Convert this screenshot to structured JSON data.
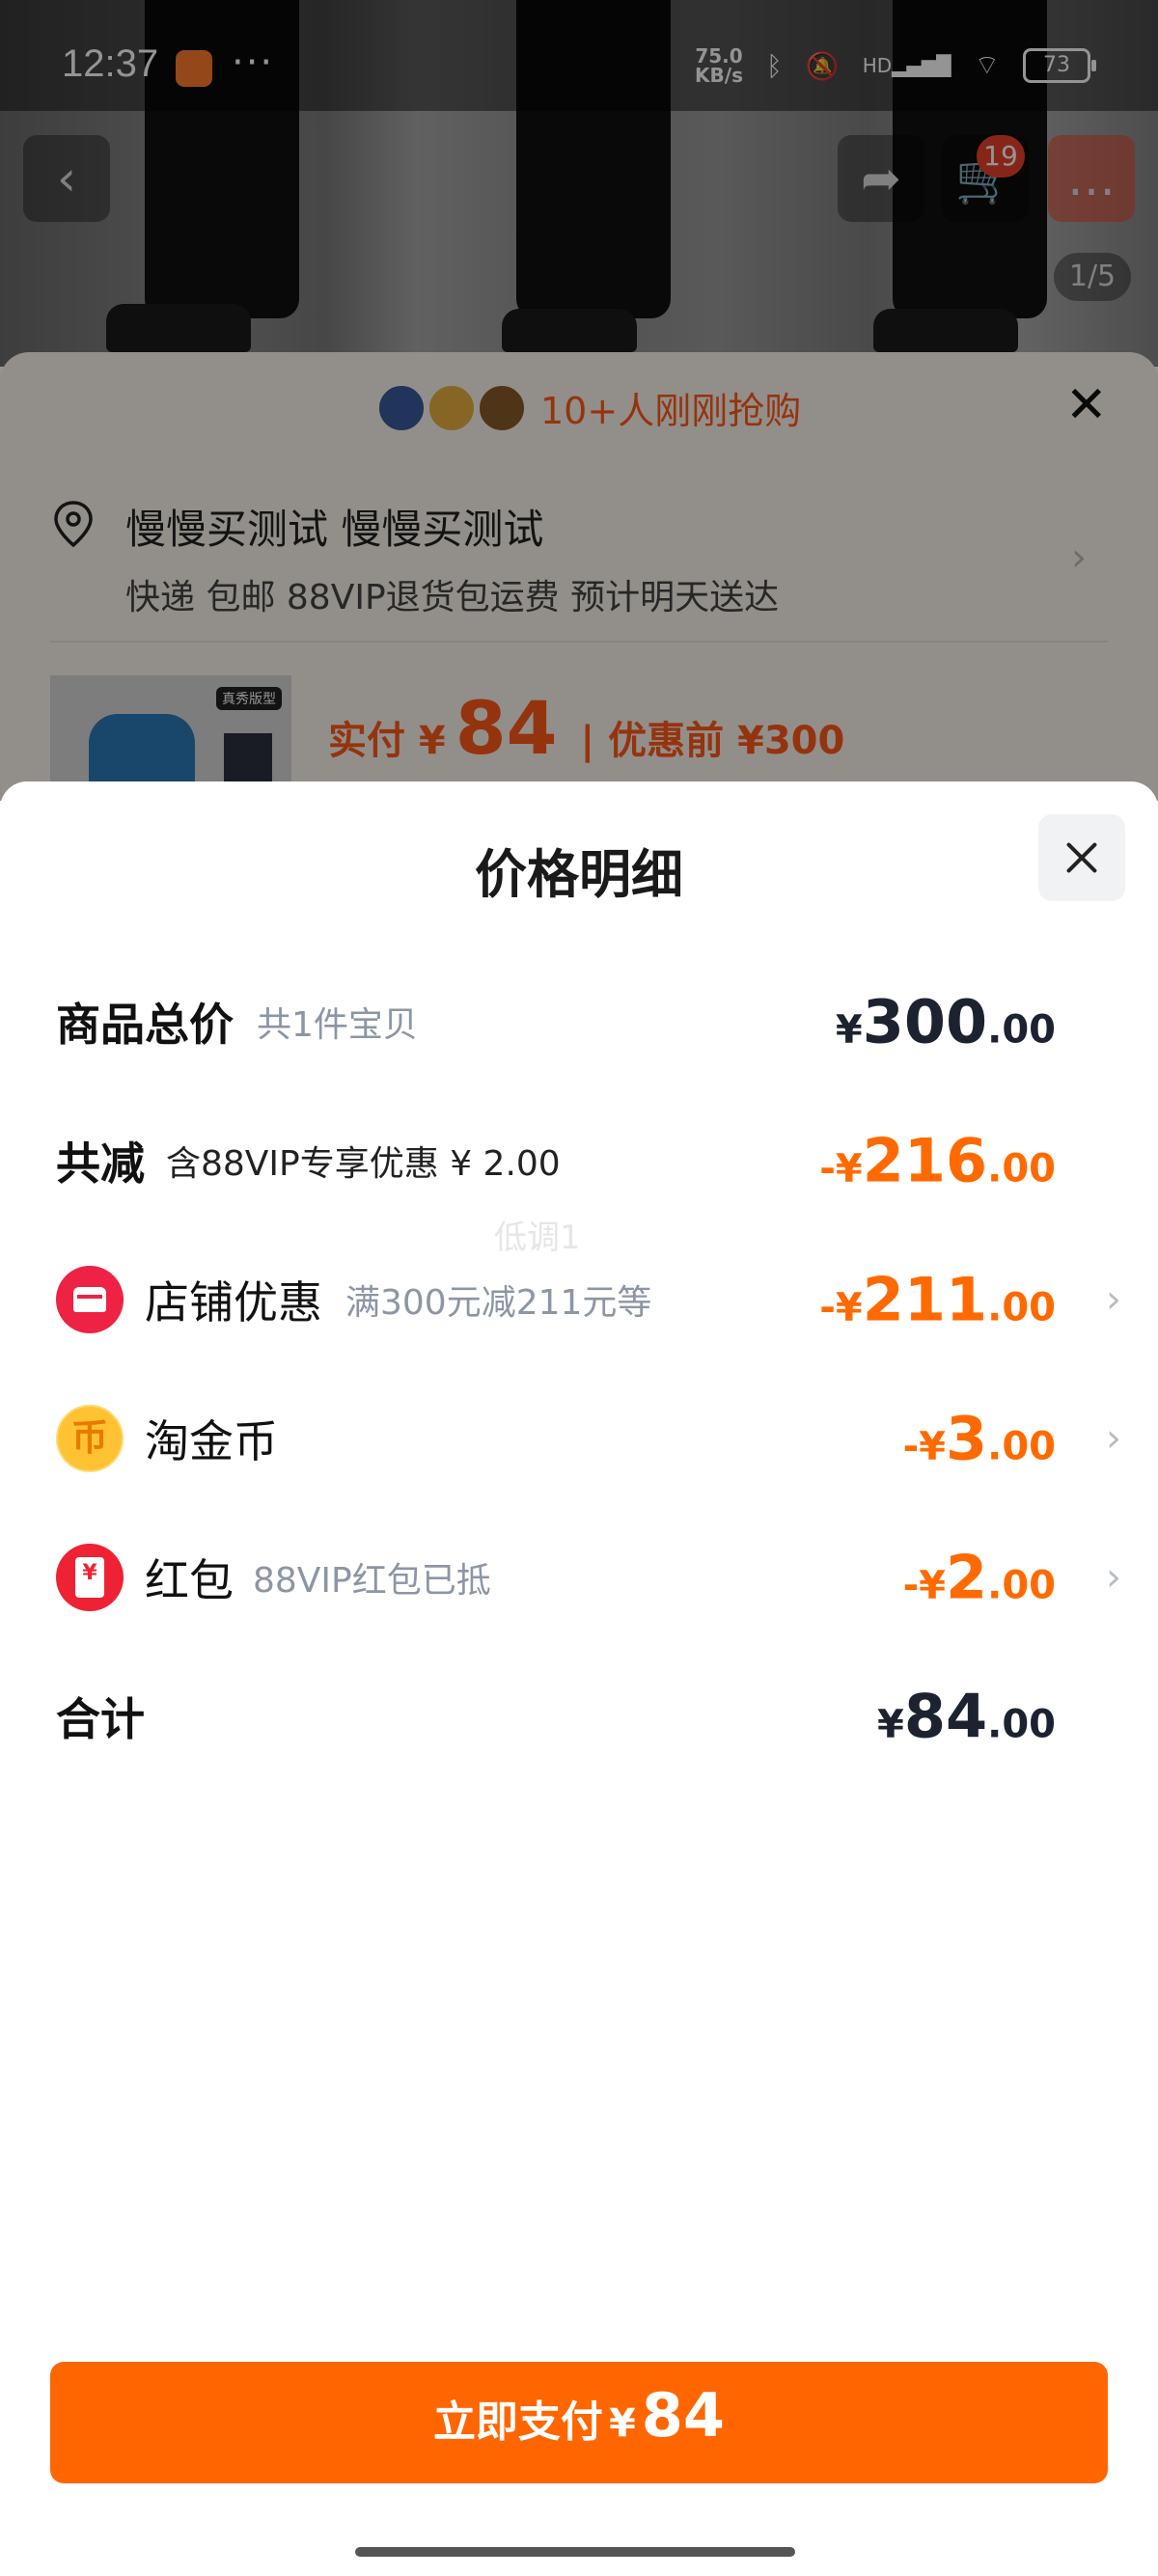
{
  "status_bar": {
    "time": "12:37",
    "more": "···",
    "net_speed_value": "75.0",
    "net_speed_unit": "KB/s",
    "signal_label": "HD",
    "battery": "73"
  },
  "product_page": {
    "cart_badge": "19",
    "image_index": "1/5",
    "buyers_text": "10+人刚刚抢购",
    "address_name": "慢慢买测试 慢慢买测试",
    "shipping": "快递 包邮 88VIP退货包运费 预计明天送达",
    "thumb_tag": "真秀版型",
    "pay_label": "实付 ¥",
    "pay_amount": "84",
    "orig_label": "| 优惠前 ¥300"
  },
  "price_detail": {
    "title": "价格明细",
    "rows": [
      {
        "title": "商品总价",
        "sub": "共1件宝贝",
        "cur": "¥",
        "int": "300",
        "dec": ".00"
      },
      {
        "title": "共减",
        "sub": "含88VIP专享优惠 ¥ 2.00",
        "cur": "-¥",
        "int": "216",
        "dec": ".00"
      },
      {
        "title": "店铺优惠",
        "sub": "满300元减211元等",
        "cur": "-¥",
        "int": "211",
        "dec": ".00"
      },
      {
        "title": "淘金币",
        "sub": "",
        "cur": "-¥",
        "int": "3",
        "dec": ".00"
      },
      {
        "title": "红包",
        "sub": "88VIP红包已抵",
        "cur": "-¥",
        "int": "2",
        "dec": ".00"
      },
      {
        "title": "合计",
        "sub": "",
        "cur": "¥",
        "int": "84",
        "dec": ".00"
      }
    ],
    "watermark": "低调1",
    "coin_glyph": "币"
  },
  "pay_button": {
    "label": "立即支付",
    "cur": "¥",
    "amount": "84"
  },
  "colors": {
    "accent": "#ff6600",
    "discount": "#ff6a00",
    "text": "#1c2230",
    "muted": "#8c96a4"
  }
}
